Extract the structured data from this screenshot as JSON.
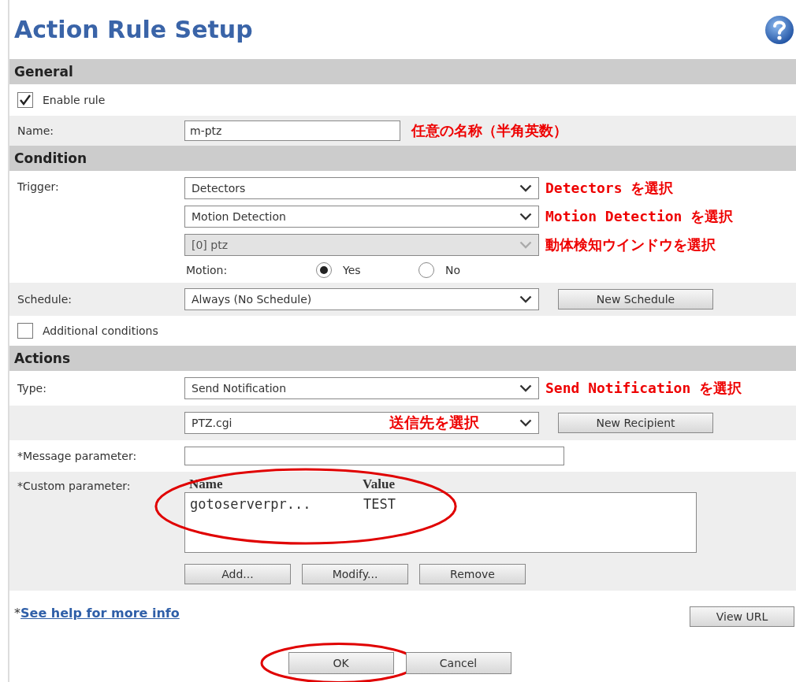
{
  "title": "Action Rule Setup",
  "general": {
    "heading": "General",
    "enable_rule": {
      "label": "Enable rule",
      "checked": true
    },
    "name": {
      "label": "Name:",
      "value": "m-ptz",
      "note": "任意の名称（半角英数）"
    }
  },
  "condition": {
    "heading": "Condition",
    "trigger": {
      "label": "Trigger:",
      "selects": [
        {
          "value": "Detectors",
          "disabled": false,
          "note": "Detectors を選択"
        },
        {
          "value": "Motion Detection",
          "disabled": false,
          "note": "Motion Detection を選択"
        },
        {
          "value": "[0] ptz",
          "disabled": true,
          "note": "動体検知ウインドウを選択"
        }
      ]
    },
    "motion": {
      "label": "Motion:",
      "options": [
        {
          "label": "Yes",
          "selected": true
        },
        {
          "label": "No",
          "selected": false
        }
      ]
    },
    "schedule": {
      "label": "Schedule:",
      "value": "Always (No Schedule)",
      "button": "New Schedule"
    },
    "additional_conditions": {
      "label": "Additional conditions",
      "checked": false
    }
  },
  "actions": {
    "heading": "Actions",
    "type": {
      "label": "Type:",
      "value": "Send Notification",
      "note": "Send Notification を選択"
    },
    "recipient": {
      "value": "PTZ.cgi",
      "note": "送信先を選択",
      "button": "New Recipient"
    },
    "message_parameter": {
      "label": "*Message parameter:"
    },
    "custom_parameter": {
      "label": "*Custom parameter:",
      "highlighted": true,
      "columns": [
        "Name",
        "Value"
      ],
      "rows": [
        {
          "name": "gotoserverpr...",
          "value": "TEST"
        }
      ],
      "buttons": [
        "Add...",
        "Modify...",
        "Remove"
      ]
    }
  },
  "help_link": {
    "prefix": "*",
    "text": "See help for more info"
  },
  "view_url": "View URL",
  "buttons": [
    {
      "label": "OK",
      "highlighted": true
    },
    {
      "label": "Cancel",
      "highlighted": false
    }
  ]
}
